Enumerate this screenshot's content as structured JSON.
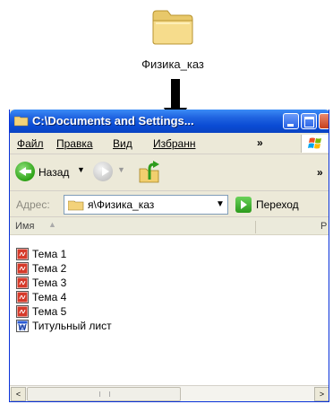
{
  "desktop": {
    "folder_label": "Физика_каз"
  },
  "window": {
    "title": "C:\\Documents and Settings...",
    "menu": [
      "Файл",
      "Правка",
      "Вид",
      "Избранн"
    ],
    "menu_more": "»",
    "toolbar": {
      "back_label": "Назад",
      "back_dropdown": "▼",
      "more": "»"
    },
    "address": {
      "label": "Адрес:",
      "value": "я\\Физика_каз",
      "dropdown": "▼",
      "go_label": "Переход"
    },
    "columns": {
      "name": "Имя",
      "name_sort_glyph": "▲",
      "size_partial": "Р"
    },
    "files": [
      {
        "name": "Тема 1",
        "type": "pdf"
      },
      {
        "name": "Тема 2",
        "type": "pdf"
      },
      {
        "name": "Тема 3",
        "type": "pdf"
      },
      {
        "name": "Тема 4",
        "type": "pdf"
      },
      {
        "name": "Тема 5",
        "type": "pdf"
      },
      {
        "name": "Титульный лист",
        "type": "doc"
      }
    ],
    "scrollbar": {
      "left_glyph": "<",
      "right_glyph": ">"
    }
  }
}
